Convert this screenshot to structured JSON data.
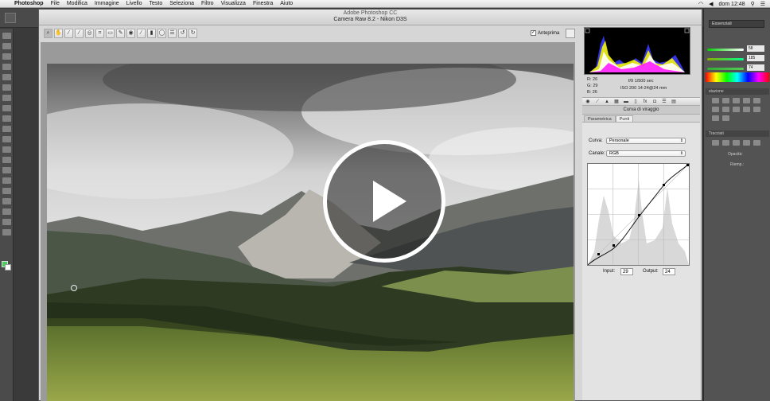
{
  "menubar": {
    "app": "Photoshop",
    "items": [
      "File",
      "Modifica",
      "Immagine",
      "Livello",
      "Testo",
      "Seleziona",
      "Filtro",
      "Visualizza",
      "Finestra",
      "Aiuto"
    ],
    "clock": "dom 12:48"
  },
  "camera_raw": {
    "app_title": "Adobe Photoshop CC",
    "window_title": "Camera Raw 8.2  -  Nikon D3S",
    "preview_label": "Anteprima",
    "preview_checked": true,
    "readout": {
      "r": "R:   26",
      "g": "G:   29",
      "b": "B:   26",
      "aperture_shutter": "f/9    1/500 sec",
      "iso_lens": "ISO 200    14-24@24 mm"
    },
    "section_title": "Curva di viraggio",
    "subtabs": [
      "Parametrica",
      "Punti"
    ],
    "active_subtab": "Punti",
    "curve_label": "Curva:",
    "curve_value": "Personale",
    "channel_label": "Canale:",
    "channel_value": "RGB",
    "input_label": "Input:",
    "input_value": "29",
    "output_label": "Output:",
    "output_value": "24"
  },
  "ps_panels": {
    "workspace": "Essenziali",
    "values": [
      "58",
      "185",
      "74"
    ],
    "adjust_title": "stazione",
    "paths_title": "Tracciati",
    "opacity_label": "Opacità:",
    "fill_label": "Riemp.:"
  },
  "colors": {
    "foreground": "#47d15c",
    "background": "#ffffff"
  },
  "icons": [
    "apple-icon",
    "wifi-icon",
    "volume-icon",
    "search-icon",
    "list-icon",
    "zoom-icon",
    "hand-icon",
    "eyedropper-icon",
    "crop-icon",
    "play-icon"
  ]
}
